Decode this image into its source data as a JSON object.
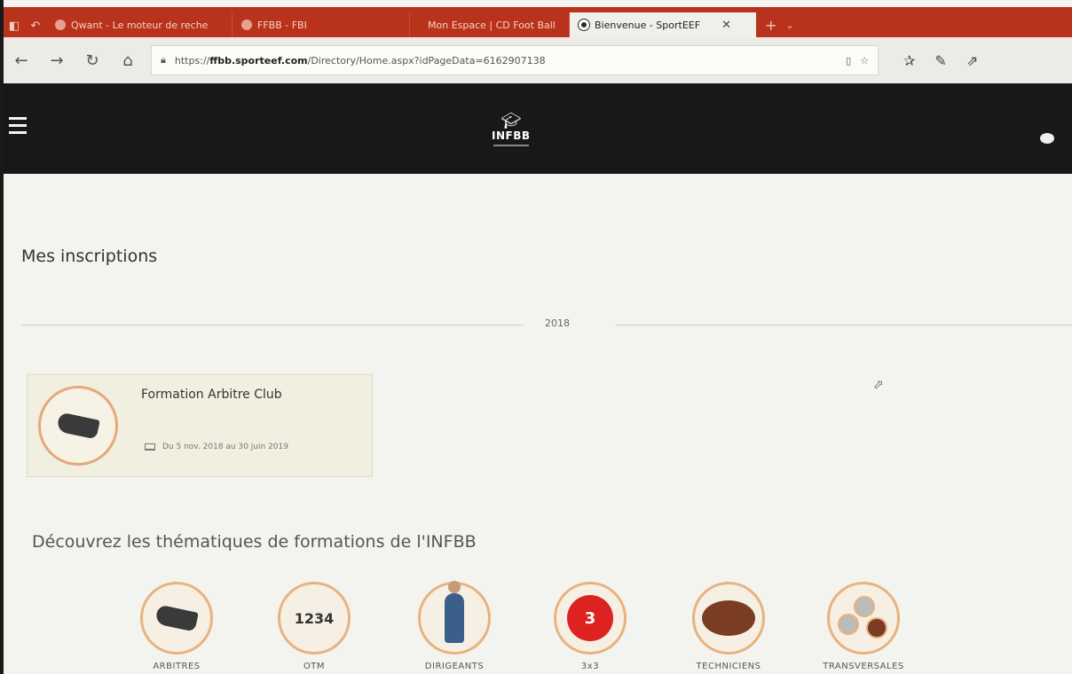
{
  "browser": {
    "tabs": [
      {
        "label": "Qwant - Le moteur de reche",
        "active": false
      },
      {
        "label": "FFBB - FBI",
        "active": false
      },
      {
        "label": "Mon Espace | CD Foot Ball",
        "active": false
      },
      {
        "label": "Bienvenue - SportEEF",
        "active": true
      }
    ],
    "url_prefix": "https://",
    "url_domain": "ffbb.sporteef.com",
    "url_path": "/Directory/Home.aspx?idPageData=6162907138",
    "colors": {
      "tabstrip": "#b8321c",
      "header": "#181818",
      "accent": "#e6a87c"
    }
  },
  "site": {
    "logo_text": "INFBB"
  },
  "inscriptions": {
    "title": "Mes inscriptions",
    "year": "2018",
    "card": {
      "title": "Formation Arbitre Club",
      "dates": "Du 5 nov. 2018 au 30 juin 2019"
    }
  },
  "themes": {
    "title": "Découvrez les thématiques de formations de l'INFBB",
    "items": [
      {
        "label": "ARBITRES",
        "icon": "whistle-icon"
      },
      {
        "label": "OTM",
        "icon": "numbers-icon"
      },
      {
        "label": "DIRIGEANTS",
        "icon": "person-icon"
      },
      {
        "label": "3x3",
        "icon": "three-by-three-icon"
      },
      {
        "label": "TECHNICIENS",
        "icon": "basketball-icon"
      },
      {
        "label": "TRANSVERSALES",
        "icon": "transversal-icon"
      }
    ]
  }
}
